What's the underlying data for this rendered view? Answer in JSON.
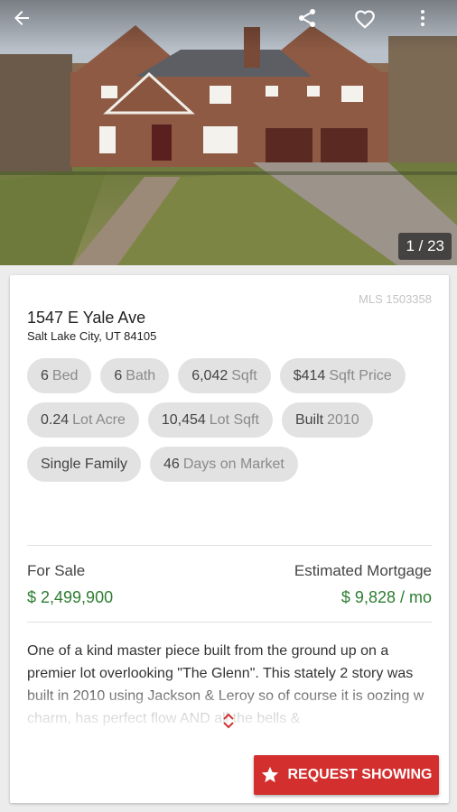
{
  "hero": {
    "photo_counter": "1 / 23"
  },
  "toolbar": {
    "icons": [
      "back-arrow-icon",
      "share-icon",
      "favorite-heart-icon",
      "more-vert-icon"
    ]
  },
  "listing": {
    "mls": "MLS 1503358",
    "address": "1547 E Yale Ave",
    "city": "Salt Lake City, UT 84105",
    "chips": [
      {
        "value": "6",
        "label": "Bed"
      },
      {
        "value": "6",
        "label": "Bath"
      },
      {
        "value": "6,042",
        "label": "Sqft"
      },
      {
        "value": "$414",
        "label": "Sqft Price"
      },
      {
        "value": "0.24",
        "label": "Lot Acre"
      },
      {
        "value": "10,454",
        "label": "Lot Sqft"
      },
      {
        "value": "Built",
        "label": "2010"
      },
      {
        "value": "Single Family",
        "label": ""
      },
      {
        "value": "46",
        "label": "Days on Market"
      }
    ],
    "sale_label": "For Sale",
    "price": "$ 2,499,900",
    "mortgage_label": "Estimated Mortgage",
    "mortgage": "$ 9,828 / mo",
    "description": "One of a kind master piece built from the ground up on a premier lot overlooking \"The Glenn\". This stately 2 story was built in 2010 using Jackson & Leroy so of course it is oozing w charm, has perfect flow AND all the bells &"
  },
  "actions": {
    "request_label": "REQUEST SHOWING"
  },
  "colors": {
    "accent": "#d32f2f",
    "price": "#2e7d32"
  }
}
